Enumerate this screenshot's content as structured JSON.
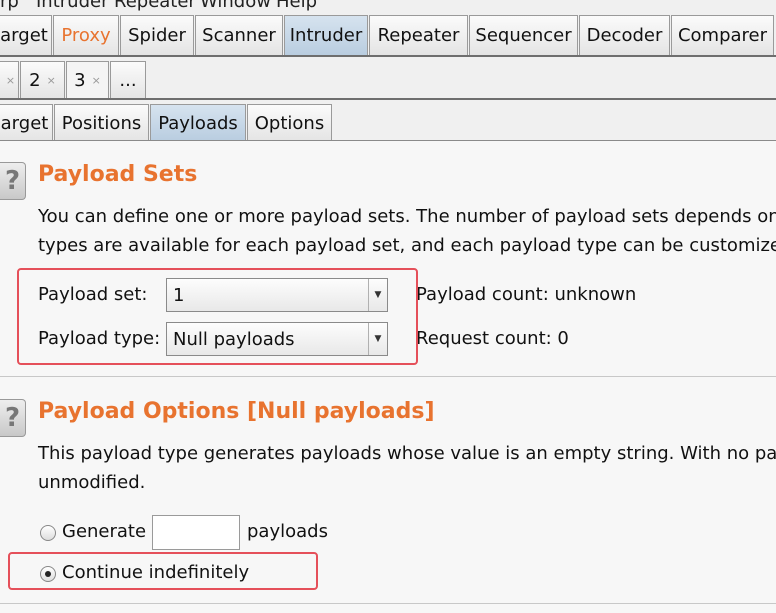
{
  "menubar": {
    "items": [
      "rp",
      "Intruder",
      "Repeater",
      "Window",
      "Help"
    ]
  },
  "main_tabs": [
    "arget",
    "Proxy",
    "Spider",
    "Scanner",
    "Intruder",
    "Repeater",
    "Sequencer",
    "Decoder",
    "Comparer"
  ],
  "attack_tabs": {
    "tab1_close": "×",
    "tab2_label": "2",
    "tab2_close": "×",
    "tab3_label": "3",
    "tab3_close": "×",
    "more_label": "..."
  },
  "sub_tabs": [
    "arget",
    "Positions",
    "Payloads",
    "Options"
  ],
  "payload_sets": {
    "help": "?",
    "title": "Payload Sets",
    "desc_line1": "You can define one or more payload sets. The number of payload sets depends on t",
    "desc_line2": "types are available for each payload set, and each payload type can be customized",
    "set_label": "Payload set:",
    "set_value": "1",
    "type_label": "Payload type:",
    "type_value": "Null payloads",
    "payload_count": "Payload count: unknown",
    "request_count": "Request count: 0",
    "combo_arrow": "▼"
  },
  "payload_options": {
    "help": "?",
    "title": "Payload Options [Null payloads]",
    "desc_line1": "This payload type generates payloads whose value is an empty string. With no paylo",
    "desc_line2": "unmodified.",
    "generate_label": "Generate",
    "generate_count": "",
    "payloads_label": "payloads",
    "continue_label": "Continue indefinitely",
    "selected_option": "Continue indefinitely"
  },
  "colors": {
    "accent_orange": "#e8732f",
    "highlight_red": "#e5505a",
    "selected_tab": "#b9cde0"
  }
}
